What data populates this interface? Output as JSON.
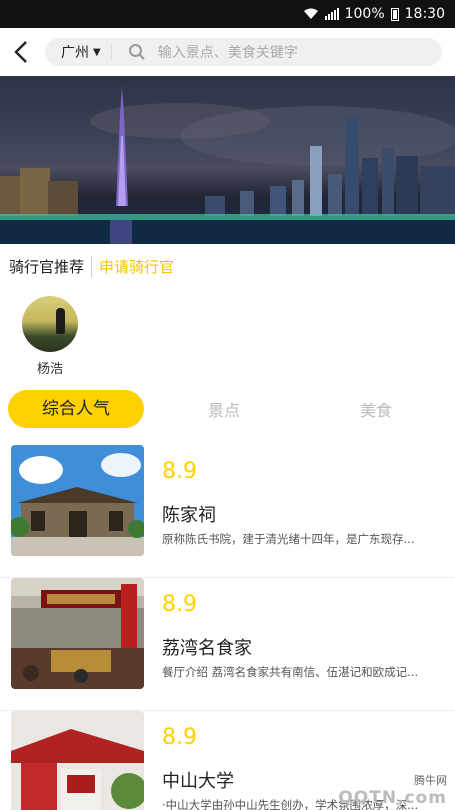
{
  "status_bar": {
    "battery": "100%",
    "time": "18:30"
  },
  "header": {
    "city": "广州",
    "search_placeholder": "输入景点、美食关键字"
  },
  "riders": {
    "title": "骑行官推荐",
    "apply_label": "申请骑行官",
    "list": [
      {
        "name": "杨浩"
      }
    ]
  },
  "tabs": [
    {
      "label": "综合人气",
      "active": true
    },
    {
      "label": "景点",
      "active": false
    },
    {
      "label": "美食",
      "active": false
    }
  ],
  "items": [
    {
      "score": "8.9",
      "name": "陈家祠",
      "desc": "原称陈氏书院，建于清光绪十四年，是广东现存..."
    },
    {
      "score": "8.9",
      "name": "荔湾名食家",
      "desc": "餐厅介绍 荔湾名食家共有南信、伍湛记和欧成记..."
    },
    {
      "score": "8.9",
      "name": "中山大学",
      "desc": "·中山大学由孙中山先生创办，学术氛围浓厚，深..."
    }
  ],
  "watermark": {
    "line1": "腾牛网",
    "line2": "QQTN.com"
  },
  "colors": {
    "accent": "#ffd100",
    "apply": "#f5c400"
  }
}
